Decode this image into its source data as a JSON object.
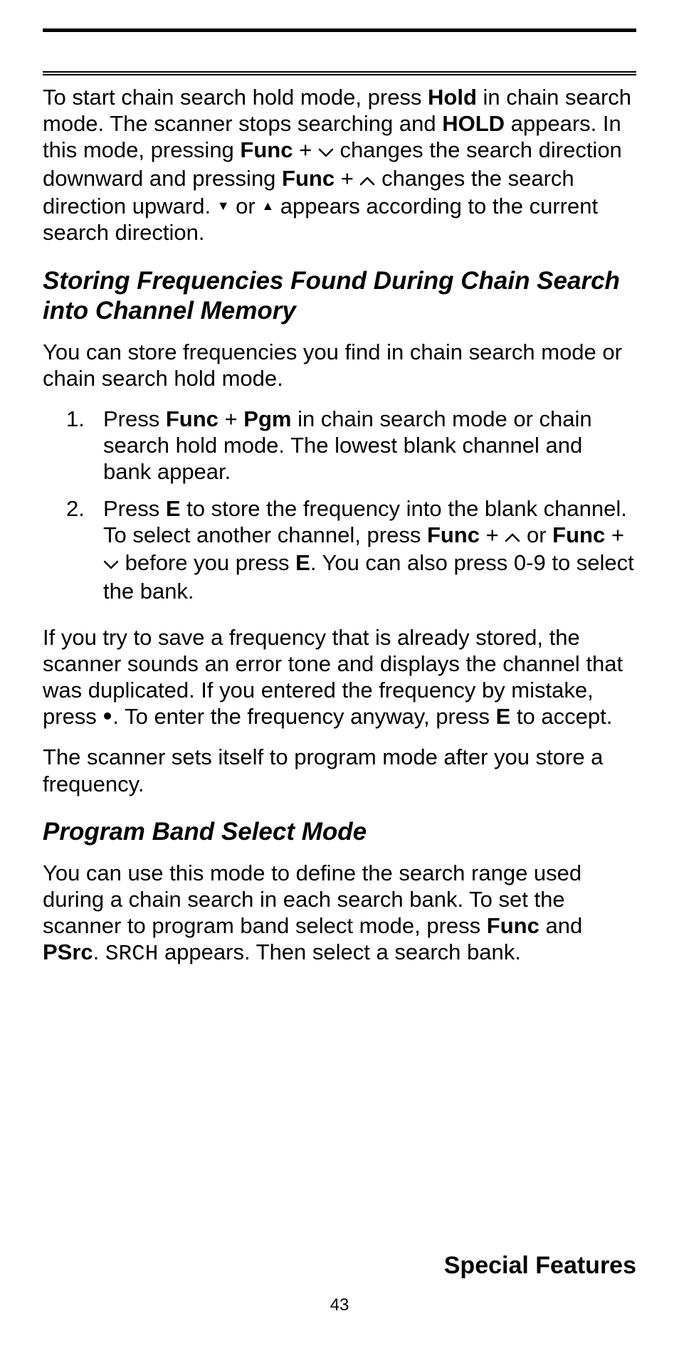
{
  "para1": {
    "part1": "To start chain search hold mode, press ",
    "hold": "Hold",
    "part2": " in chain search mode. The scanner stops searching and ",
    "hold_caps": "HOLD",
    "part3": " appears. In this mode, pressing ",
    "func1": "Func",
    "plus1": " + ",
    "part4": " changes the search direction downward and pressing ",
    "func2": "Func",
    "plus2": " + ",
    "part5": "  changes the search direction upward. ",
    "or": " or ",
    "part6": "  appears according to the current search direction."
  },
  "heading1": "Storing Frequencies Found During Chain Search into Channel Memory",
  "para2": "You can store frequencies you find in chain search mode or chain search hold mode.",
  "list": {
    "item1": {
      "a": "Press ",
      "func": "Func",
      "plus": " + ",
      "pgm": "Pgm",
      "b": " in chain search mode or chain search hold mode. The lowest blank channel and bank appear."
    },
    "item2": {
      "a": "Press ",
      "e1": "E",
      "b": " to store the frequency into the blank channel. To select another channel, press ",
      "func1": "Func",
      "plus1": " + ",
      "or": " or ",
      "func2": "Func",
      "plus2": " + ",
      "c": " before you press ",
      "e2": "E",
      "d": ". You can also press 0-9 to select the bank."
    }
  },
  "para3": {
    "a": "If you try to save a frequency that is already stored, the scanner sounds an error tone and displays the channel that was duplicated. If you entered the fre­quency by mistake, press ",
    "b": ". To enter the frequency anyway, press ",
    "e": "E",
    "c": " to accept."
  },
  "para4": "The scanner sets itself to program mode after you store a frequency.",
  "heading2": "Program Band Select Mode",
  "para5": {
    "a": "You can use this mode to define the search range used during a chain search in each search bank. To set the scanner to program band select mode, press ",
    "func": "Func",
    "and": " and ",
    "psrc": "PSrc",
    "dot": ". ",
    "srch": "SRCH",
    "b": " appears. Then select a search bank."
  },
  "footer": "Special Features",
  "page_number": "43"
}
